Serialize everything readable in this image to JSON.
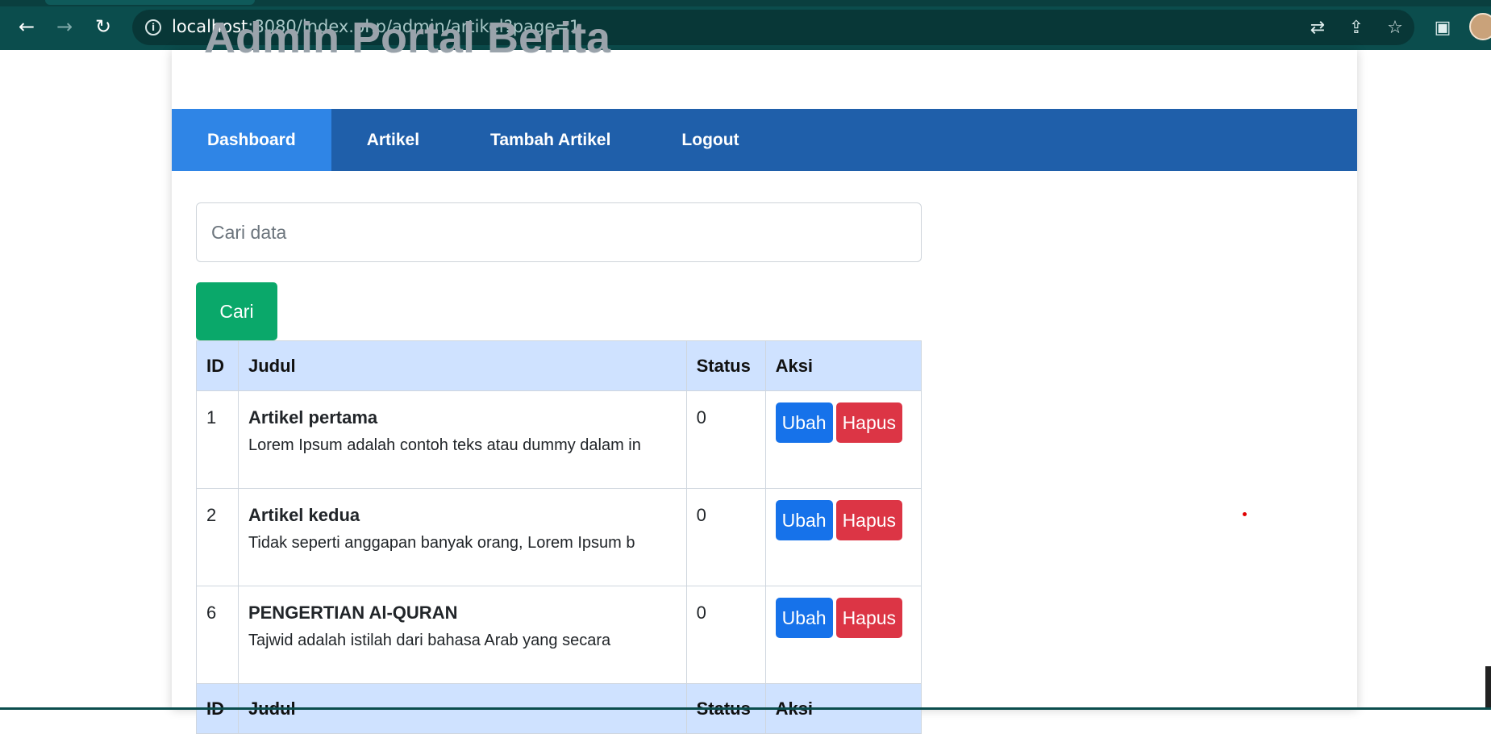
{
  "browser": {
    "url_host": "localhost",
    "url_rest": ":8080/index.php/admin/artikel?page=1",
    "back_icon": "←",
    "forward_icon": "→",
    "reload_icon": "↻",
    "info_icon": "i",
    "translate_icon": "⇄",
    "share_icon": "⇪",
    "star_icon": "☆",
    "sidepanel_icon": "▣"
  },
  "site": {
    "title": "Admin Portal Berita"
  },
  "nav": {
    "items": [
      {
        "label": "Dashboard"
      },
      {
        "label": "Artikel"
      },
      {
        "label": "Tambah Artikel"
      },
      {
        "label": "Logout"
      }
    ]
  },
  "search": {
    "placeholder": "Cari data",
    "button": "Cari"
  },
  "table": {
    "headers": {
      "id": "ID",
      "judul": "Judul",
      "status": "Status",
      "aksi": "Aksi"
    },
    "rows": [
      {
        "id": "1",
        "title": "Artikel pertama",
        "excerpt": "Lorem Ipsum adalah contoh teks atau dummy dalam in",
        "status": "0",
        "edit": "Ubah",
        "delete": "Hapus"
      },
      {
        "id": "2",
        "title": "Artikel kedua",
        "excerpt": "Tidak seperti anggapan banyak orang, Lorem Ipsum b",
        "status": "0",
        "edit": "Ubah",
        "delete": "Hapus"
      },
      {
        "id": "6",
        "title": "PENGERTIAN Al-QURAN",
        "excerpt": "Tajwid adalah istilah dari bahasa Arab yang secara",
        "status": "0",
        "edit": "Ubah",
        "delete": "Hapus"
      }
    ]
  },
  "colors": {
    "navbar": "#1f5faa",
    "nav_active": "#2f85e6",
    "search_button": "#0aa86a",
    "edit_button": "#1672ea",
    "delete_button": "#dc3545",
    "table_header": "#cfe2ff"
  }
}
